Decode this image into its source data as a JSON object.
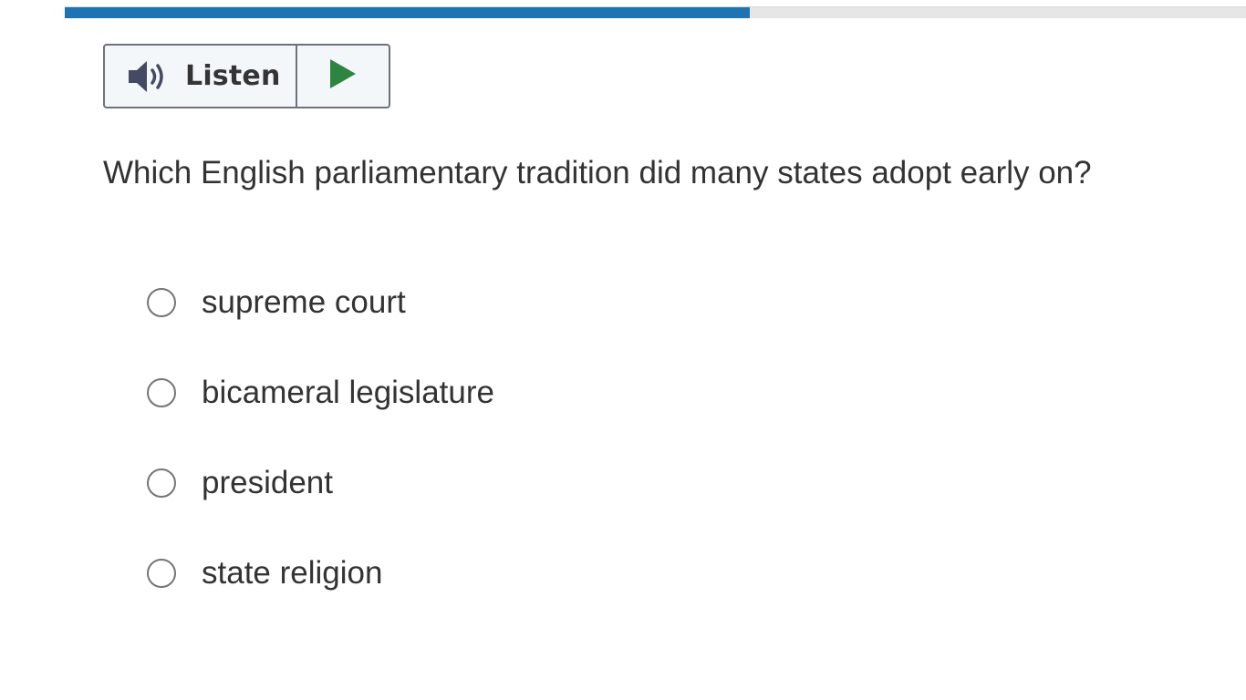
{
  "progress": {
    "fraction": 0.58,
    "fill_color": "#1e73b2",
    "track_color": "#e6e6e6"
  },
  "listen": {
    "label": "Listen",
    "icon": "speaker-volume-icon",
    "play_icon": "play-icon",
    "play_color": "#2e8540"
  },
  "question": {
    "text": "Which English parliamentary tradition did many states adopt early on?"
  },
  "options": [
    {
      "label": "supreme court",
      "selected": false
    },
    {
      "label": "bicameral legislature",
      "selected": false
    },
    {
      "label": "president",
      "selected": false
    },
    {
      "label": "state religion",
      "selected": false
    }
  ]
}
